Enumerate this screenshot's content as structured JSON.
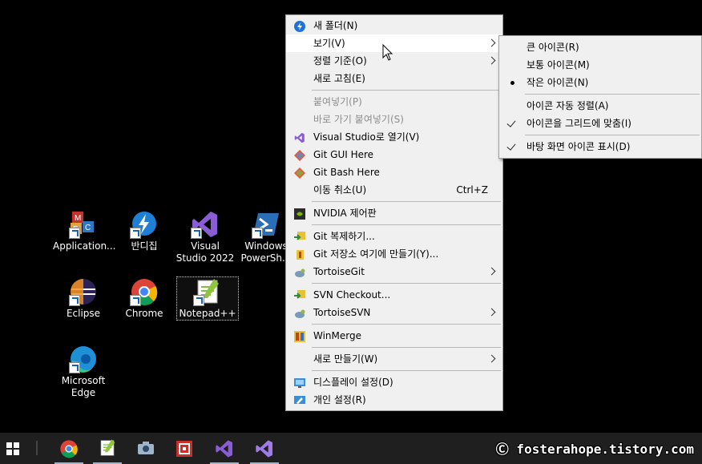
{
  "desktop": {
    "icons": [
      {
        "label": "Application..."
      },
      {
        "label": "반디집"
      },
      {
        "label": "Visual Studio 2022"
      },
      {
        "label": "Windows PowerSh..."
      },
      {
        "label": "Eclipse"
      },
      {
        "label": "Chrome"
      },
      {
        "label": "Notepad++"
      },
      {
        "label": "Microsoft Edge"
      }
    ]
  },
  "context_menu": {
    "items": [
      {
        "label": "새 폴더(N)",
        "icon": "new-folder-icon"
      },
      {
        "label": "보기(V)",
        "has_submenu": true
      },
      {
        "label": "정렬 기준(O)",
        "has_submenu": true
      },
      {
        "label": "새로 고침(E)"
      },
      {
        "label": "붙여넣기(P)",
        "disabled": true
      },
      {
        "label": "바로 가기 붙여넣기(S)",
        "disabled": true
      },
      {
        "label": "Visual Studio로 열기(V)",
        "icon": "visual-studio-icon"
      },
      {
        "label": "Git GUI Here",
        "icon": "git-gui-icon"
      },
      {
        "label": "Git Bash Here",
        "icon": "git-bash-icon"
      },
      {
        "label": "이동 취소(U)",
        "shortcut": "Ctrl+Z"
      },
      {
        "label": "NVIDIA 제어판",
        "icon": "nvidia-icon"
      },
      {
        "label": "Git 복제하기...",
        "icon": "tortoisegit-clone-icon"
      },
      {
        "label": "Git 저장소 여기에 만들기(Y)...",
        "icon": "tortoisegit-create-icon"
      },
      {
        "label": "TortoiseGit",
        "icon": "tortoisegit-icon",
        "has_submenu": true
      },
      {
        "label": "SVN Checkout...",
        "icon": "svn-checkout-icon"
      },
      {
        "label": "TortoiseSVN",
        "icon": "tortoisesvn-icon",
        "has_submenu": true
      },
      {
        "label": "WinMerge",
        "icon": "winmerge-icon"
      },
      {
        "label": "새로 만들기(W)",
        "has_submenu": true
      },
      {
        "label": "디스플레이 설정(D)",
        "icon": "display-settings-icon"
      },
      {
        "label": "개인 설정(R)",
        "icon": "personalize-icon"
      }
    ]
  },
  "view_submenu": {
    "items": [
      {
        "label": "큰 아이콘(R)"
      },
      {
        "label": "보통 아이콘(M)"
      },
      {
        "label": "작은 아이콘(N)",
        "selected": true
      },
      {
        "label": "아이콘 자동 정렬(A)"
      },
      {
        "label": "아이콘을 그리드에 맞춤(I)",
        "checked": true
      },
      {
        "label": "바탕 화면 아이콘 표시(D)",
        "checked": true
      }
    ]
  },
  "taskbar": {
    "items": [
      "start-icon",
      "chrome-icon",
      "notepadpp-icon",
      "camera-icon",
      "app-icon",
      "visual-studio-icon",
      "visual-studio-icon"
    ]
  },
  "watermark": "Ⓒ fosterahope.tistory.com",
  "colors": {
    "menu_bg": "#f0f0f0",
    "highlight": "#ffffff",
    "taskbar": "#1f1f1f",
    "desktop": "#000000"
  }
}
